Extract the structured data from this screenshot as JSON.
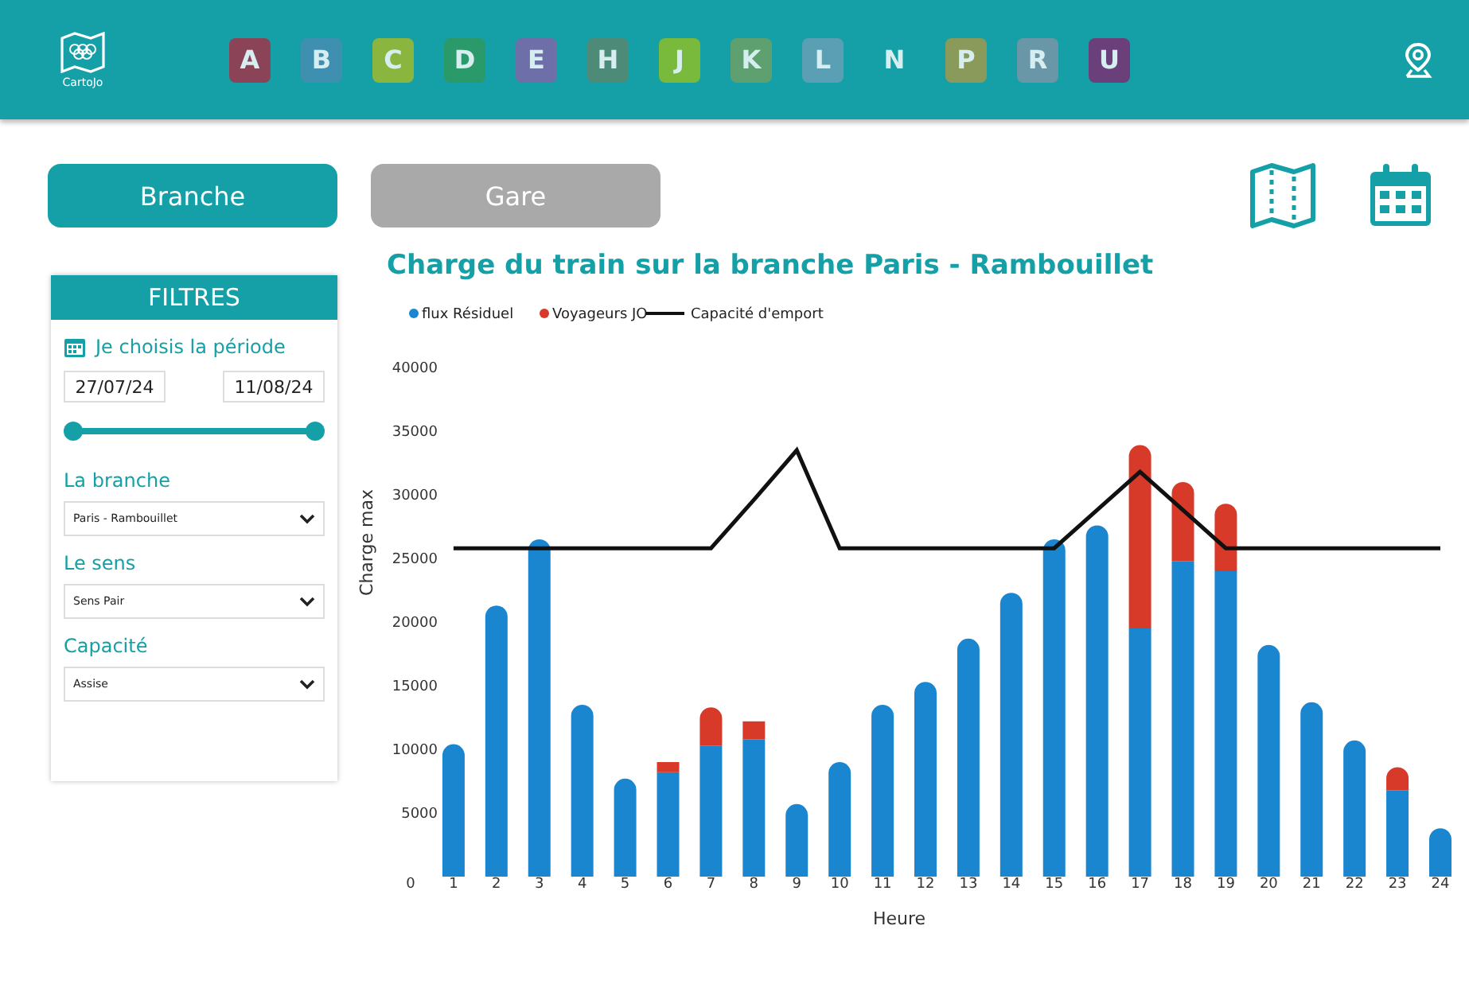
{
  "header": {
    "logo_text": "CartoJo",
    "lines": [
      {
        "label": "A",
        "color": "#8b4457"
      },
      {
        "label": "B",
        "color": "#3f8fb0"
      },
      {
        "label": "C",
        "color": "#8ab63f"
      },
      {
        "label": "D",
        "color": "#2b9a6a"
      },
      {
        "label": "E",
        "color": "#6e6ea8"
      },
      {
        "label": "H",
        "color": "#4d8a78"
      },
      {
        "label": "J",
        "color": "#79b93b"
      },
      {
        "label": "K",
        "color": "#5fa070"
      },
      {
        "label": "L",
        "color": "#5b9fb5"
      },
      {
        "label": "N",
        "color": "#14a0a6"
      },
      {
        "label": "P",
        "color": "#8a9a5a"
      },
      {
        "label": "R",
        "color": "#6a97a8"
      },
      {
        "label": "U",
        "color": "#6b3f7a"
      }
    ]
  },
  "view_tabs": [
    {
      "label": "Branche",
      "selected": true
    },
    {
      "label": "Gare",
      "selected": false
    }
  ],
  "filters": {
    "title": "FILTRES",
    "period_label": "Je choisis la période",
    "date_from": "27/07/24",
    "date_to": "11/08/24",
    "period_slider": {
      "level": 1
    },
    "selects": [
      {
        "label": "La branche",
        "value": "Paris - Rambouillet"
      },
      {
        "label": "Le sens",
        "value": "Sens Pair"
      },
      {
        "label": "Capacité",
        "value": "Assise"
      }
    ]
  },
  "chart": {
    "title": "Charge du train sur la branche Paris - Rambouillet",
    "chart_data": {
      "type": "bar",
      "stacked": true,
      "legend": "top",
      "xlabel": "Heure",
      "ylabel": "Charge max",
      "x": [
        1,
        2,
        3,
        4,
        5,
        6,
        7,
        8,
        9,
        10,
        11,
        12,
        13,
        14,
        15,
        16,
        17,
        18,
        19,
        20,
        21,
        22,
        23,
        24
      ],
      "xlim": [
        0,
        24
      ],
      "xticks": [
        0,
        1,
        2,
        3,
        4,
        5,
        6,
        7,
        8,
        9,
        10,
        11,
        12,
        13,
        14,
        15,
        16,
        17,
        18,
        19,
        20,
        21,
        22,
        23,
        24
      ],
      "ylim": [
        0,
        40000
      ],
      "yticks": [
        5000,
        10000,
        15000,
        20000,
        25000,
        30000,
        35000,
        40000
      ],
      "series": [
        {
          "name": "flux Résiduel",
          "type": "bar",
          "color": "#1a86d0",
          "values": [
            10400,
            21300,
            26500,
            13500,
            7700,
            8200,
            10300,
            10800,
            5700,
            9000,
            13500,
            15300,
            18700,
            22300,
            26500,
            27600,
            19500,
            24800,
            24000,
            18200,
            13700,
            10700,
            6800,
            3800
          ]
        },
        {
          "name": "Voyageurs JO",
          "type": "bar",
          "color": "#d83a2a",
          "values": [
            0,
            0,
            0,
            0,
            0,
            800,
            3000,
            1400,
            0,
            0,
            0,
            0,
            0,
            0,
            0,
            0,
            14400,
            6200,
            5300,
            0,
            0,
            0,
            1800,
            0
          ]
        },
        {
          "name": "Capacité d'emport",
          "type": "line",
          "color": "#111111",
          "values": [
            25800,
            25800,
            25800,
            25800,
            25800,
            25800,
            25800,
            29600,
            33500,
            25800,
            25800,
            25800,
            25800,
            25800,
            25800,
            28800,
            31800,
            28800,
            25800,
            25800,
            25800,
            25800,
            25800,
            25800
          ]
        }
      ]
    }
  }
}
